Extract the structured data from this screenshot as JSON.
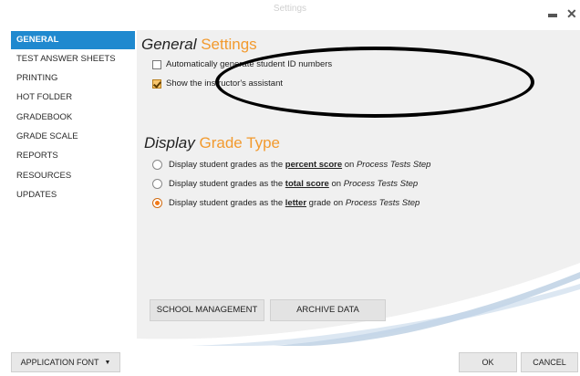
{
  "window": {
    "title": "Settings",
    "minimize_icon": "minimize-icon",
    "close_icon": "close-icon"
  },
  "sidebar": {
    "active_index": 0,
    "active_color": "#1f89cf",
    "items": [
      {
        "label": "GENERAL"
      },
      {
        "label": "TEST ANSWER SHEETS"
      },
      {
        "label": "PRINTING"
      },
      {
        "label": "HOT FOLDER"
      },
      {
        "label": "GRADEBOOK"
      },
      {
        "label": "GRADE SCALE"
      },
      {
        "label": "REPORTS"
      },
      {
        "label": "RESOURCES"
      },
      {
        "label": "UPDATES"
      }
    ]
  },
  "general_settings": {
    "title_part1": "General",
    "title_part2": "Settings",
    "options": [
      {
        "label": "Automatically generate student ID numbers",
        "checked": false
      },
      {
        "label": "Show the instructor's assistant",
        "checked": true
      }
    ]
  },
  "display_grade_type": {
    "title_part1": "Display",
    "title_part2": "Grade Type",
    "options": [
      {
        "pre": "Display student grades as the ",
        "em": "percent score",
        "post": " on ",
        "step": "Process Tests Step",
        "selected": false
      },
      {
        "pre": "Display student grades as the ",
        "em": "total score",
        "post": " on ",
        "step": "Process Tests Step",
        "selected": false
      },
      {
        "pre": "Display student grades as the ",
        "em": "letter",
        "post": " grade on ",
        "step": "Process Tests Step",
        "selected": true
      }
    ]
  },
  "buttons": {
    "school_management": "SCHOOL MANAGEMENT",
    "archive_data": "ARCHIVE DATA"
  },
  "footer": {
    "application_font": "APPLICATION FONT",
    "ok": "OK",
    "cancel": "CANCEL"
  },
  "colors": {
    "accent_blue": "#1f89cf",
    "accent_orange": "#f29a2e",
    "panel_background": "#f0f0f0"
  }
}
